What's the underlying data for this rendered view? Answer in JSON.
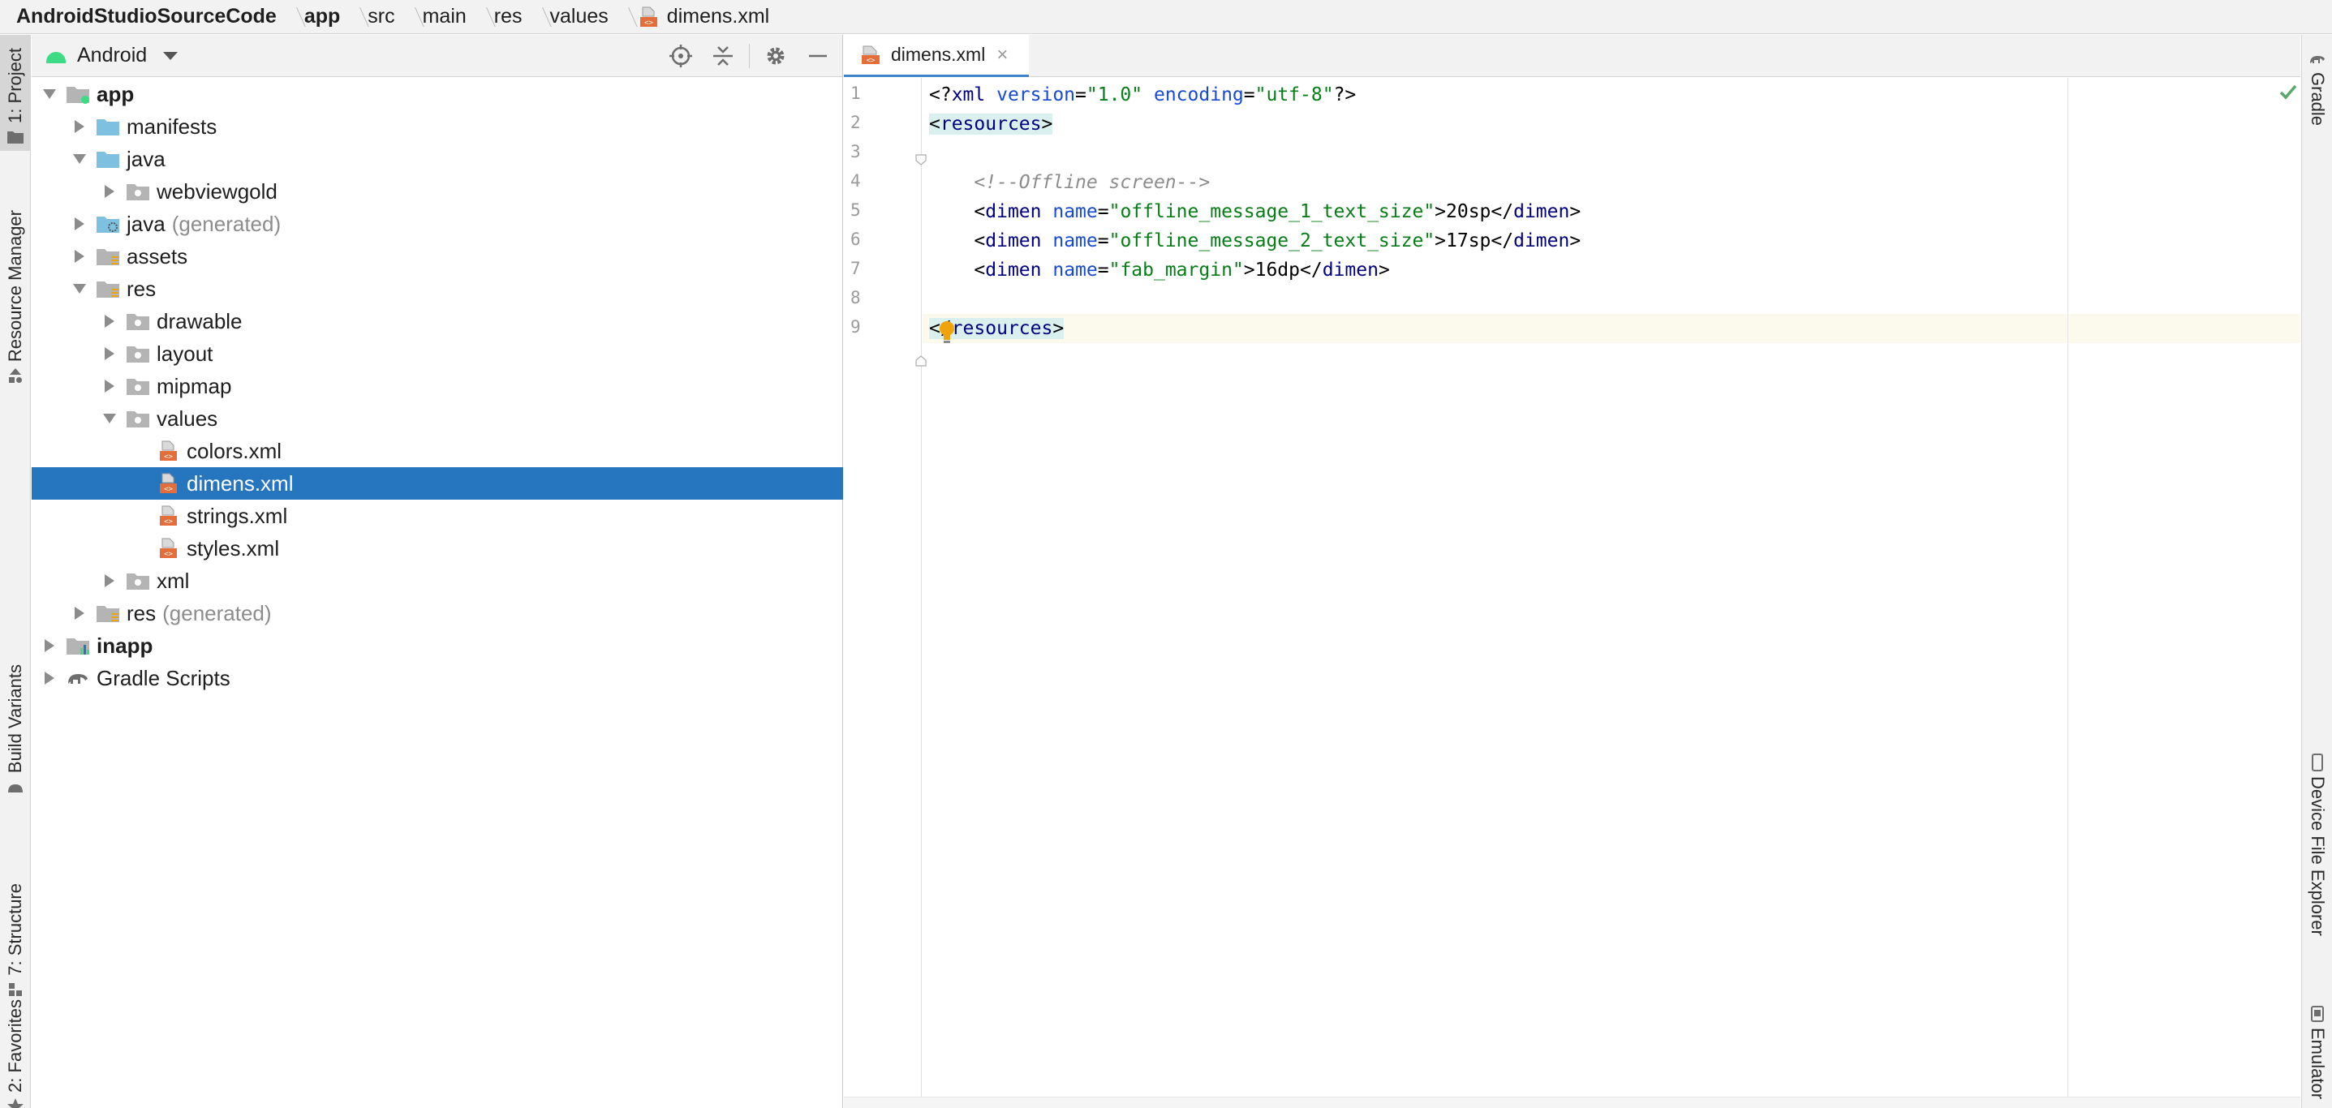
{
  "breadcrumb": [
    {
      "label": "AndroidStudioSourceCode",
      "bold": true
    },
    {
      "label": "app",
      "bold": true
    },
    {
      "label": "src",
      "bold": false
    },
    {
      "label": "main",
      "bold": false
    },
    {
      "label": "res",
      "bold": false
    },
    {
      "label": "values",
      "bold": false
    },
    {
      "label": "dimens.xml",
      "bold": false,
      "icon": "xml-file-icon"
    }
  ],
  "left_tool_tabs": [
    {
      "label": "1: Project",
      "icon": "folder-icon",
      "active": true
    },
    {
      "label": "Resource Manager",
      "icon": "resource-manager-icon",
      "active": false
    },
    {
      "label": "Build Variants",
      "icon": "android-icon",
      "active": false
    },
    {
      "label": "7: Structure",
      "icon": "structure-icon",
      "active": false
    },
    {
      "label": "2: Favorites",
      "icon": "star-icon",
      "active": false
    }
  ],
  "right_tool_tabs": [
    {
      "label": "Gradle",
      "icon": "gradle-elephant-icon"
    },
    {
      "label": "Device File Explorer",
      "icon": "device-icon"
    },
    {
      "label": "Emulator",
      "icon": "emulator-icon"
    }
  ],
  "project_panel": {
    "view_mode": "Android",
    "header_icons": [
      "locate-icon",
      "collapse-all-icon",
      "gear-icon",
      "hide-icon"
    ],
    "tree": [
      {
        "label": "app",
        "suffix": "",
        "level": 0,
        "arrow": "down",
        "icon": "module-folder-icon",
        "bold": true
      },
      {
        "label": "manifests",
        "suffix": "",
        "level": 1,
        "arrow": "right",
        "icon": "folder-icon",
        "bold": false
      },
      {
        "label": "java",
        "suffix": "",
        "level": 1,
        "arrow": "down",
        "icon": "folder-icon",
        "bold": false
      },
      {
        "label": "webviewgold",
        "suffix": "",
        "level": 2,
        "arrow": "right",
        "icon": "package-icon",
        "bold": false
      },
      {
        "label": "java",
        "suffix": "(generated)",
        "level": 1,
        "arrow": "right",
        "icon": "generated-folder-icon",
        "bold": false
      },
      {
        "label": "assets",
        "suffix": "",
        "level": 1,
        "arrow": "right",
        "icon": "resource-folder-icon",
        "bold": false
      },
      {
        "label": "res",
        "suffix": "",
        "level": 1,
        "arrow": "down",
        "icon": "resource-folder-icon",
        "bold": false
      },
      {
        "label": "drawable",
        "suffix": "",
        "level": 2,
        "arrow": "right",
        "icon": "package-icon",
        "bold": false
      },
      {
        "label": "layout",
        "suffix": "",
        "level": 2,
        "arrow": "right",
        "icon": "package-icon",
        "bold": false
      },
      {
        "label": "mipmap",
        "suffix": "",
        "level": 2,
        "arrow": "right",
        "icon": "package-icon",
        "bold": false
      },
      {
        "label": "values",
        "suffix": "",
        "level": 2,
        "arrow": "down",
        "icon": "package-icon",
        "bold": false
      },
      {
        "label": "colors.xml",
        "suffix": "",
        "level": 3,
        "arrow": "none",
        "icon": "xml-file-icon",
        "bold": false
      },
      {
        "label": "dimens.xml",
        "suffix": "",
        "level": 3,
        "arrow": "none",
        "icon": "xml-file-icon",
        "bold": false,
        "selected": true
      },
      {
        "label": "strings.xml",
        "suffix": "",
        "level": 3,
        "arrow": "none",
        "icon": "xml-file-icon",
        "bold": false
      },
      {
        "label": "styles.xml",
        "suffix": "",
        "level": 3,
        "arrow": "none",
        "icon": "xml-file-icon",
        "bold": false
      },
      {
        "label": "xml",
        "suffix": "",
        "level": 2,
        "arrow": "right",
        "icon": "package-icon",
        "bold": false
      },
      {
        "label": "res",
        "suffix": "(generated)",
        "level": 1,
        "arrow": "right",
        "icon": "resource-folder-icon",
        "bold": false
      },
      {
        "label": "inapp",
        "suffix": "",
        "level": 0,
        "arrow": "right",
        "icon": "library-module-icon",
        "bold": true
      },
      {
        "label": "Gradle Scripts",
        "suffix": "",
        "level": 0,
        "arrow": "right",
        "icon": "gradle-elephant-icon",
        "bold": false
      }
    ]
  },
  "editor": {
    "tab": {
      "label": "dimens.xml",
      "close": "×"
    },
    "lines": [
      {
        "num": "1",
        "tokens": [
          {
            "t": "plain",
            "v": "<?"
          },
          {
            "t": "tag",
            "v": "xml "
          },
          {
            "t": "attr",
            "v": "version"
          },
          {
            "t": "plain",
            "v": "="
          },
          {
            "t": "val",
            "v": "\"1.0\" "
          },
          {
            "t": "attr",
            "v": "encoding"
          },
          {
            "t": "plain",
            "v": "="
          },
          {
            "t": "val",
            "v": "\"utf-8\""
          },
          {
            "t": "plain",
            "v": "?>"
          }
        ]
      },
      {
        "num": "2",
        "tokens": [
          {
            "t": "hlplain",
            "v": "<"
          },
          {
            "t": "hltag",
            "v": "resources"
          },
          {
            "t": "hlplain",
            "v": ">"
          }
        ]
      },
      {
        "num": "3",
        "tokens": []
      },
      {
        "num": "4",
        "tokens": [
          {
            "t": "plain",
            "v": "    "
          },
          {
            "t": "comment",
            "v": "<!--Offline screen-->"
          }
        ]
      },
      {
        "num": "5",
        "tokens": [
          {
            "t": "plain",
            "v": "    <"
          },
          {
            "t": "tag",
            "v": "dimen "
          },
          {
            "t": "attr",
            "v": "name"
          },
          {
            "t": "plain",
            "v": "="
          },
          {
            "t": "val",
            "v": "\"offline_message_1_text_size\""
          },
          {
            "t": "plain",
            "v": ">20sp</"
          },
          {
            "t": "tag",
            "v": "dimen"
          },
          {
            "t": "plain",
            "v": ">"
          }
        ]
      },
      {
        "num": "6",
        "tokens": [
          {
            "t": "plain",
            "v": "    <"
          },
          {
            "t": "tag",
            "v": "dimen "
          },
          {
            "t": "attr",
            "v": "name"
          },
          {
            "t": "plain",
            "v": "="
          },
          {
            "t": "val",
            "v": "\"offline_message_2_text_size\""
          },
          {
            "t": "plain",
            "v": ">17sp</"
          },
          {
            "t": "tag",
            "v": "dimen"
          },
          {
            "t": "plain",
            "v": ">"
          }
        ]
      },
      {
        "num": "7",
        "tokens": [
          {
            "t": "plain",
            "v": "    <"
          },
          {
            "t": "tag",
            "v": "dimen "
          },
          {
            "t": "attr",
            "v": "name"
          },
          {
            "t": "plain",
            "v": "="
          },
          {
            "t": "val",
            "v": "\"fab_margin\""
          },
          {
            "t": "plain",
            "v": ">16dp</"
          },
          {
            "t": "tag",
            "v": "dimen"
          },
          {
            "t": "plain",
            "v": ">"
          }
        ]
      },
      {
        "num": "8",
        "tokens": []
      },
      {
        "num": "9",
        "tokens": [
          {
            "t": "hlplain",
            "v": "</"
          },
          {
            "t": "hltag",
            "v": "resources"
          },
          {
            "t": "hlplain",
            "v": ">"
          }
        ],
        "current": true
      }
    ]
  },
  "colors": {
    "selection": "#2675bf",
    "folder_blue": "#7dc0e0",
    "xml_orange": "#e56d3a",
    "android_green": "#3ddc84",
    "check_green": "#59a869",
    "bulb_yellow": "#f0a30a"
  }
}
